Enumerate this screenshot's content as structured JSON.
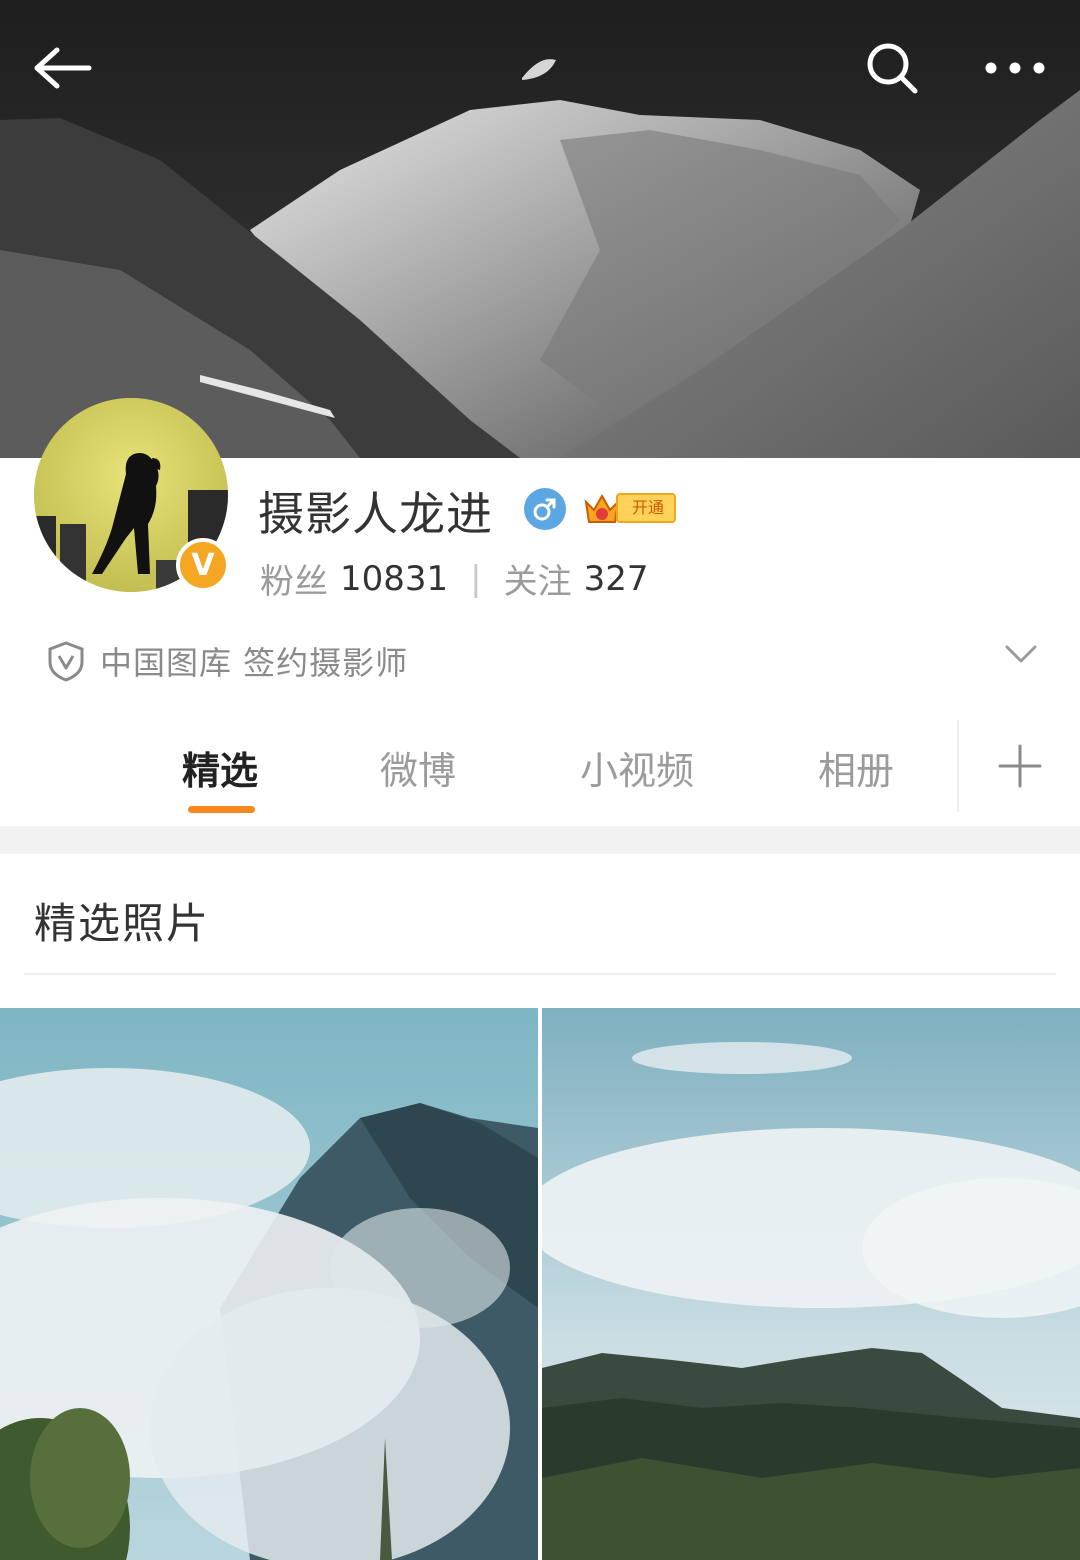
{
  "profile": {
    "username": "摄影人龙进",
    "vip_label": "开通",
    "followers_label": "粉丝",
    "followers_count": "10831",
    "following_label": "关注",
    "following_count": "327",
    "certification": "中国图库 签约摄影师"
  },
  "tabs": [
    {
      "label": "精选",
      "active": true
    },
    {
      "label": "微博",
      "active": false
    },
    {
      "label": "小视频",
      "active": false
    },
    {
      "label": "相册",
      "active": false
    }
  ],
  "section": {
    "title": "精选照片"
  },
  "colors": {
    "accent": "#f5891f",
    "verify_badge": "#f5a623",
    "gender": "#5aa7e4",
    "vip_gold": "#ffd35a"
  },
  "icons": [
    "back-arrow-icon",
    "search-icon",
    "more-icon",
    "shield-icon",
    "chevron-down-icon",
    "plus-icon",
    "male-icon",
    "crown-icon"
  ]
}
